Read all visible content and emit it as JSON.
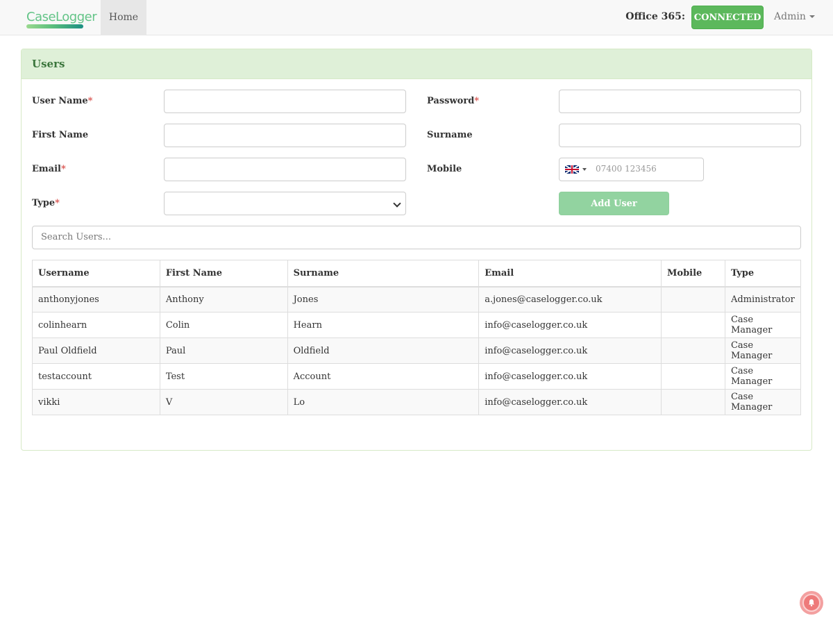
{
  "navbar": {
    "logo_text": "CaseLogger",
    "home_label": "Home",
    "office365_label": "Office 365:",
    "connection_status": "CONNECTED",
    "admin_label": "Admin"
  },
  "panel": {
    "title": "Users"
  },
  "form": {
    "username_label": "User Name",
    "password_label": "Password",
    "firstname_label": "First Name",
    "surname_label": "Surname",
    "email_label": "Email",
    "mobile_label": "Mobile",
    "type_label": "Type",
    "required_mark": "*",
    "mobile_placeholder": "07400 123456",
    "add_user_label": "Add User"
  },
  "search": {
    "placeholder": "Search Users..."
  },
  "table": {
    "headers": [
      "Username",
      "First Name",
      "Surname",
      "Email",
      "Mobile",
      "Type"
    ],
    "rows": [
      [
        "anthonyjones",
        "Anthony",
        "Jones",
        "a.jones@caselogger.co.uk",
        "",
        "Administrator"
      ],
      [
        "colinhearn",
        "Colin",
        "Hearn",
        "info@caselogger.co.uk",
        "",
        "Case Manager"
      ],
      [
        "Paul Oldfield",
        "Paul",
        "Oldfield",
        "info@caselogger.co.uk",
        "",
        "Case Manager"
      ],
      [
        "testaccount",
        "Test",
        "Account",
        "info@caselogger.co.uk",
        "",
        "Case Manager"
      ],
      [
        "vikki",
        "V",
        "Lo",
        "info@caselogger.co.uk",
        "",
        "Case Manager"
      ]
    ]
  },
  "colors": {
    "connected": "#5cb85c",
    "panel_heading_bg": "#dff0d8",
    "panel_heading_text": "#3c763d",
    "add_button": "#92d3a0",
    "required": "#d9534f"
  },
  "icons": {
    "flag": "uk-flag-icon",
    "bell": "bell-icon"
  }
}
